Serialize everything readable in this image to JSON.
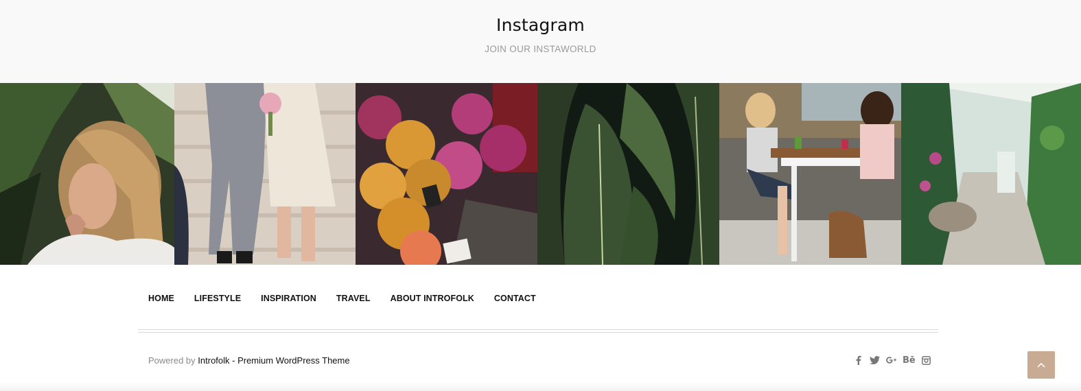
{
  "instagram_section": {
    "title": "Instagram",
    "subtitle": "JOIN OUR INSTAWORLD",
    "photos": [
      {
        "subject": "woman with long hair among plants"
      },
      {
        "subject": "wedding couple walking down stairs"
      },
      {
        "subject": "bouquets of chrysanthemum flowers"
      },
      {
        "subject": "large dark green tropical leaves"
      },
      {
        "subject": "two women laughing at a cafe table"
      },
      {
        "subject": "greenhouse path with plants"
      }
    ]
  },
  "footer_nav": {
    "items": [
      "HOME",
      "LIFESTYLE",
      "INSPIRATION",
      "TRAVEL",
      "ABOUT INTROFOLK",
      "CONTACT"
    ]
  },
  "credits": {
    "prefix": "Powered by",
    "link": "Introfolk - Premium WordPress Theme"
  },
  "social": {
    "icons": [
      "facebook-icon",
      "twitter-icon",
      "google-plus-icon",
      "behance-icon",
      "instagram-icon"
    ],
    "behance_label": "Bē"
  },
  "colors": {
    "header_bg": "#f9f9f9",
    "subtitle": "#9a9a9a",
    "accent": "#c9aa93",
    "icon": "#777777"
  }
}
